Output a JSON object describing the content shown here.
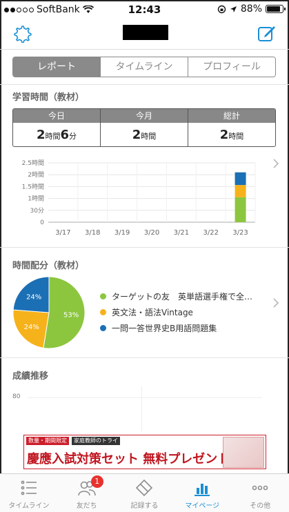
{
  "status_bar": {
    "carrier": "SoftBank",
    "time": "12:43",
    "battery": "88%",
    "battery_level": 0.88
  },
  "segmented": {
    "tabs": [
      "レポート",
      "タイムライン",
      "プロフィール"
    ],
    "active_index": 0
  },
  "study_time": {
    "title": "学習時間（教材）",
    "columns": [
      {
        "label": "今日",
        "hours": "2",
        "hours_unit": "時間",
        "minutes": "6",
        "minutes_unit": "分"
      },
      {
        "label": "今月",
        "hours": "2",
        "hours_unit": "時間"
      },
      {
        "label": "総計",
        "hours": "2",
        "hours_unit": "時間"
      }
    ]
  },
  "chart_data": {
    "type": "bar",
    "stacked": true,
    "categories": [
      "3/17",
      "3/18",
      "3/19",
      "3/20",
      "3/21",
      "3/22",
      "3/23"
    ],
    "y_tick_labels": [
      "0",
      "30分",
      "1時間",
      "1.5時間",
      "2時間",
      "2.5時間"
    ],
    "ylim": [
      0,
      150
    ],
    "grid": true,
    "series": [
      {
        "color": "#8cc63f",
        "values": [
          0,
          0,
          0,
          0,
          0,
          0,
          63
        ]
      },
      {
        "color": "#f6b21b",
        "values": [
          0,
          0,
          0,
          0,
          0,
          0,
          31
        ]
      },
      {
        "color": "#1b6fb5",
        "values": [
          0,
          0,
          0,
          0,
          0,
          0,
          32
        ]
      }
    ]
  },
  "distribution": {
    "title": "時間配分（教材）",
    "slices": [
      {
        "name": "ターゲットの友　英単語選手権で全…",
        "percent": 53,
        "label": "53%",
        "color": "#8cc63f"
      },
      {
        "name": "英文法・語法Vintage",
        "percent": 24,
        "label": "24%",
        "color": "#f6b21b"
      },
      {
        "name": "一問一答世界史B用語問題集",
        "percent": 24,
        "label": "24%",
        "color": "#1b6fb5"
      }
    ]
  },
  "grades": {
    "title": "成績推移",
    "y_tick": "80"
  },
  "ad": {
    "tag1": "数量・期間限定",
    "tag2": "家庭教師のトライ",
    "headline": "慶應入試対策セット 無料プレゼント!"
  },
  "tabbar": {
    "tabs": [
      {
        "label": "タイムライン"
      },
      {
        "label": "友だち",
        "badge": "1"
      },
      {
        "label": "記録する"
      },
      {
        "label": "マイページ"
      },
      {
        "label": "その他"
      }
    ],
    "active_index": 3
  },
  "colors": {
    "accent": "#1a8fd6",
    "segment_active": "#8a8a8a",
    "green": "#8cc63f",
    "yellow": "#f6b21b",
    "blue": "#1b6fb5",
    "badge": "#e8322e"
  }
}
